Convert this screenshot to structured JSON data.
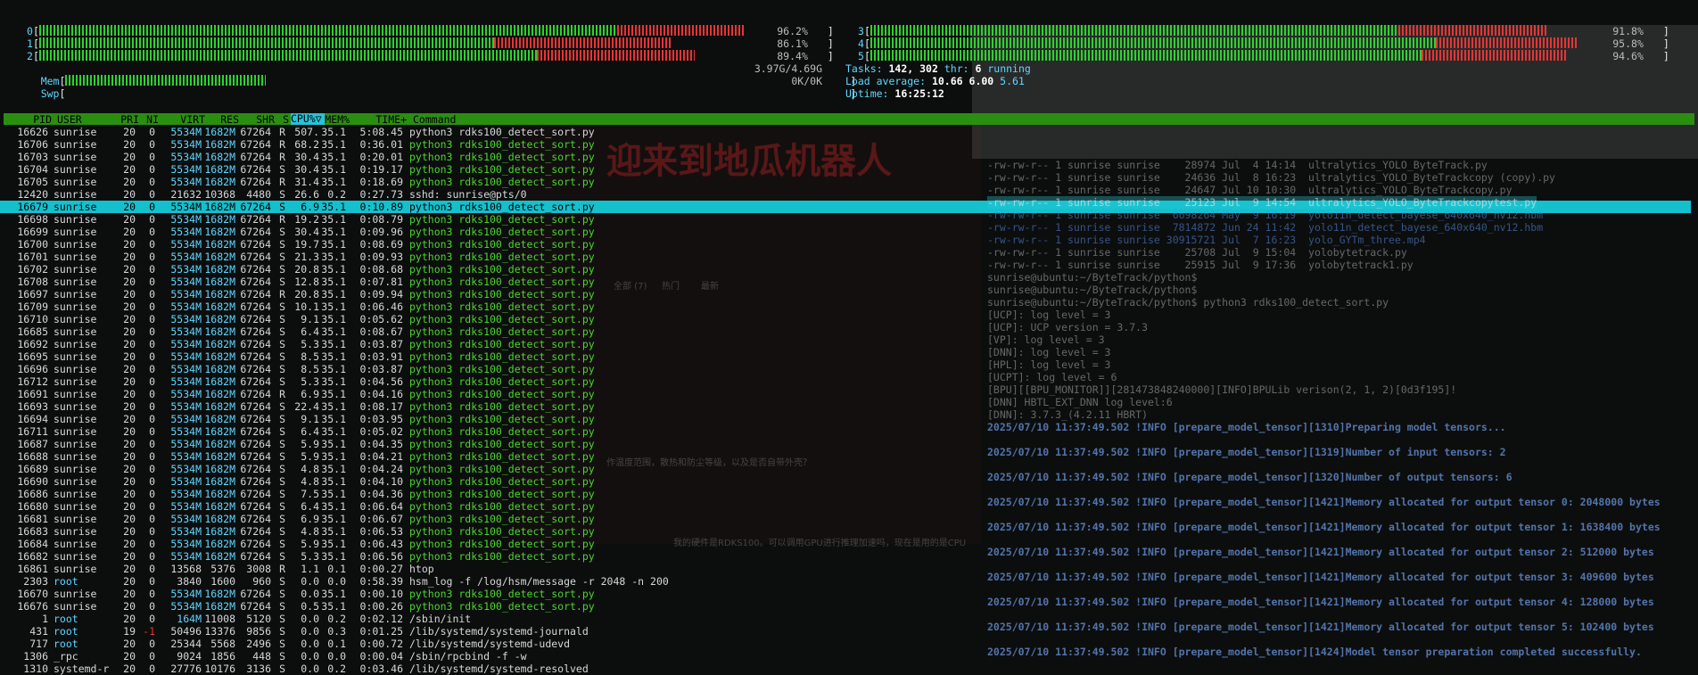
{
  "cpu_meters": [
    {
      "label": "0",
      "value": "96.2%",
      "pct": 96.2,
      "red_from": 0.82
    },
    {
      "label": "1",
      "value": "86.1%",
      "pct": 86.1,
      "red_from": 0.72
    },
    {
      "label": "2",
      "value": "89.4%",
      "pct": 89.4,
      "red_from": 0.76
    },
    {
      "label": "3",
      "value": "91.8%",
      "pct": 91.8,
      "red_from": 0.78
    },
    {
      "label": "4",
      "value": "95.8%",
      "pct": 95.8,
      "red_from": 0.8
    },
    {
      "label": "5",
      "value": "94.6%",
      "pct": 94.6,
      "red_from": 0.79
    }
  ],
  "mem": {
    "label": "Mem",
    "value": "3.97G/4.69G",
    "pct": 85
  },
  "swp": {
    "label": "Swp",
    "value": "0K/0K",
    "pct": 0
  },
  "summary": {
    "tasks_label": "Tasks:",
    "tasks": "142,",
    "thr": "302",
    "thr_label": "thr:",
    "running": "6",
    "running_label": "running",
    "load_label": "Load average:",
    "load1": "10.66",
    "load5": "6.00",
    "load15": "5.61",
    "uptime_label": "Uptime:",
    "uptime": "16:25:12"
  },
  "header": {
    "pid": "PID",
    "user": "USER",
    "pri": "PRI",
    "ni": "NI",
    "virt": "VIRT",
    "res": "RES",
    "shr": "SHR",
    "s": "S",
    "cpu": "CPU%▽",
    "mem": "MEM%",
    "time": "TIME+",
    "command": "Command"
  },
  "processes": [
    {
      "pid": "16626",
      "user": "sunrise",
      "pri": "20",
      "ni": "0",
      "virt": "5534M",
      "res": "1682M",
      "shr": "67264",
      "s": "R",
      "cpu": "507.",
      "mem": "35.1",
      "time": "5:08.45",
      "cmd": "python3 rdks100_detect_sort.py",
      "green": false
    },
    {
      "pid": "16706",
      "user": "sunrise",
      "pri": "20",
      "ni": "0",
      "virt": "5534M",
      "res": "1682M",
      "shr": "67264",
      "s": "R",
      "cpu": "68.2",
      "mem": "35.1",
      "time": "0:36.01",
      "cmd": "python3 rdks100_detect_sort.py",
      "green": true
    },
    {
      "pid": "16703",
      "user": "sunrise",
      "pri": "20",
      "ni": "0",
      "virt": "5534M",
      "res": "1682M",
      "shr": "67264",
      "s": "R",
      "cpu": "30.4",
      "mem": "35.1",
      "time": "0:20.01",
      "cmd": "python3 rdks100_detect_sort.py",
      "green": true
    },
    {
      "pid": "16704",
      "user": "sunrise",
      "pri": "20",
      "ni": "0",
      "virt": "5534M",
      "res": "1682M",
      "shr": "67264",
      "s": "S",
      "cpu": "30.4",
      "mem": "35.1",
      "time": "0:19.17",
      "cmd": "python3 rdks100_detect_sort.py",
      "green": true
    },
    {
      "pid": "16705",
      "user": "sunrise",
      "pri": "20",
      "ni": "0",
      "virt": "5534M",
      "res": "1682M",
      "shr": "67264",
      "s": "R",
      "cpu": "31.4",
      "mem": "35.1",
      "time": "0:18.69",
      "cmd": "python3 rdks100_detect_sort.py",
      "green": true
    },
    {
      "pid": "12420",
      "user": "sunrise",
      "pri": "20",
      "ni": "0",
      "virt": "21632",
      "res": "10368",
      "shr": "4480",
      "s": "S",
      "cpu": "26.6",
      "mem": "0.2",
      "time": "0:27.73",
      "cmd": "sshd: sunrise@pts/0",
      "green": false
    },
    {
      "pid": "16679",
      "user": "sunrise",
      "pri": "20",
      "ni": "0",
      "virt": "5534M",
      "res": "1682M",
      "shr": "67264",
      "s": "S",
      "cpu": "6.9",
      "mem": "35.1",
      "time": "0:10.89",
      "cmd": "python3 rdks100_detect_sort.py",
      "green": true,
      "hl": true
    },
    {
      "pid": "16698",
      "user": "sunrise",
      "pri": "20",
      "ni": "0",
      "virt": "5534M",
      "res": "1682M",
      "shr": "67264",
      "s": "R",
      "cpu": "19.2",
      "mem": "35.1",
      "time": "0:08.79",
      "cmd": "python3 rdks100_detect_sort.py",
      "green": true
    },
    {
      "pid": "16699",
      "user": "sunrise",
      "pri": "20",
      "ni": "0",
      "virt": "5534M",
      "res": "1682M",
      "shr": "67264",
      "s": "S",
      "cpu": "30.4",
      "mem": "35.1",
      "time": "0:09.96",
      "cmd": "python3 rdks100_detect_sort.py",
      "green": true
    },
    {
      "pid": "16700",
      "user": "sunrise",
      "pri": "20",
      "ni": "0",
      "virt": "5534M",
      "res": "1682M",
      "shr": "67264",
      "s": "S",
      "cpu": "19.7",
      "mem": "35.1",
      "time": "0:08.69",
      "cmd": "python3 rdks100_detect_sort.py",
      "green": true
    },
    {
      "pid": "16701",
      "user": "sunrise",
      "pri": "20",
      "ni": "0",
      "virt": "5534M",
      "res": "1682M",
      "shr": "67264",
      "s": "S",
      "cpu": "21.3",
      "mem": "35.1",
      "time": "0:09.93",
      "cmd": "python3 rdks100_detect_sort.py",
      "green": true
    },
    {
      "pid": "16702",
      "user": "sunrise",
      "pri": "20",
      "ni": "0",
      "virt": "5534M",
      "res": "1682M",
      "shr": "67264",
      "s": "S",
      "cpu": "20.8",
      "mem": "35.1",
      "time": "0:08.68",
      "cmd": "python3 rdks100_detect_sort.py",
      "green": true
    },
    {
      "pid": "16708",
      "user": "sunrise",
      "pri": "20",
      "ni": "0",
      "virt": "5534M",
      "res": "1682M",
      "shr": "67264",
      "s": "S",
      "cpu": "12.8",
      "mem": "35.1",
      "time": "0:07.81",
      "cmd": "python3 rdks100_detect_sort.py",
      "green": true
    },
    {
      "pid": "16697",
      "user": "sunrise",
      "pri": "20",
      "ni": "0",
      "virt": "5534M",
      "res": "1682M",
      "shr": "67264",
      "s": "R",
      "cpu": "20.8",
      "mem": "35.1",
      "time": "0:09.94",
      "cmd": "python3 rdks100_detect_sort.py",
      "green": true
    },
    {
      "pid": "16709",
      "user": "sunrise",
      "pri": "20",
      "ni": "0",
      "virt": "5534M",
      "res": "1682M",
      "shr": "67264",
      "s": "S",
      "cpu": "10.1",
      "mem": "35.1",
      "time": "0:06.46",
      "cmd": "python3 rdks100_detect_sort.py",
      "green": true
    },
    {
      "pid": "16710",
      "user": "sunrise",
      "pri": "20",
      "ni": "0",
      "virt": "5534M",
      "res": "1682M",
      "shr": "67264",
      "s": "S",
      "cpu": "9.1",
      "mem": "35.1",
      "time": "0:05.62",
      "cmd": "python3 rdks100_detect_sort.py",
      "green": true
    },
    {
      "pid": "16685",
      "user": "sunrise",
      "pri": "20",
      "ni": "0",
      "virt": "5534M",
      "res": "1682M",
      "shr": "67264",
      "s": "S",
      "cpu": "6.4",
      "mem": "35.1",
      "time": "0:08.67",
      "cmd": "python3 rdks100_detect_sort.py",
      "green": true
    },
    {
      "pid": "16692",
      "user": "sunrise",
      "pri": "20",
      "ni": "0",
      "virt": "5534M",
      "res": "1682M",
      "shr": "67264",
      "s": "S",
      "cpu": "5.3",
      "mem": "35.1",
      "time": "0:03.87",
      "cmd": "python3 rdks100_detect_sort.py",
      "green": true
    },
    {
      "pid": "16695",
      "user": "sunrise",
      "pri": "20",
      "ni": "0",
      "virt": "5534M",
      "res": "1682M",
      "shr": "67264",
      "s": "S",
      "cpu": "8.5",
      "mem": "35.1",
      "time": "0:03.91",
      "cmd": "python3 rdks100_detect_sort.py",
      "green": true
    },
    {
      "pid": "16696",
      "user": "sunrise",
      "pri": "20",
      "ni": "0",
      "virt": "5534M",
      "res": "1682M",
      "shr": "67264",
      "s": "S",
      "cpu": "8.5",
      "mem": "35.1",
      "time": "0:03.87",
      "cmd": "python3 rdks100_detect_sort.py",
      "green": true
    },
    {
      "pid": "16712",
      "user": "sunrise",
      "pri": "20",
      "ni": "0",
      "virt": "5534M",
      "res": "1682M",
      "shr": "67264",
      "s": "S",
      "cpu": "5.3",
      "mem": "35.1",
      "time": "0:04.56",
      "cmd": "python3 rdks100_detect_sort.py",
      "green": true
    },
    {
      "pid": "16691",
      "user": "sunrise",
      "pri": "20",
      "ni": "0",
      "virt": "5534M",
      "res": "1682M",
      "shr": "67264",
      "s": "R",
      "cpu": "6.9",
      "mem": "35.1",
      "time": "0:04.16",
      "cmd": "python3 rdks100_detect_sort.py",
      "green": true
    },
    {
      "pid": "16693",
      "user": "sunrise",
      "pri": "20",
      "ni": "0",
      "virt": "5534M",
      "res": "1682M",
      "shr": "67264",
      "s": "S",
      "cpu": "22.4",
      "mem": "35.1",
      "time": "0:08.17",
      "cmd": "python3 rdks100_detect_sort.py",
      "green": true
    },
    {
      "pid": "16694",
      "user": "sunrise",
      "pri": "20",
      "ni": "0",
      "virt": "5534M",
      "res": "1682M",
      "shr": "67264",
      "s": "S",
      "cpu": "9.1",
      "mem": "35.1",
      "time": "0:03.95",
      "cmd": "python3 rdks100_detect_sort.py",
      "green": true
    },
    {
      "pid": "16711",
      "user": "sunrise",
      "pri": "20",
      "ni": "0",
      "virt": "5534M",
      "res": "1682M",
      "shr": "67264",
      "s": "S",
      "cpu": "6.4",
      "mem": "35.1",
      "time": "0:05.02",
      "cmd": "python3 rdks100_detect_sort.py",
      "green": true
    },
    {
      "pid": "16687",
      "user": "sunrise",
      "pri": "20",
      "ni": "0",
      "virt": "5534M",
      "res": "1682M",
      "shr": "67264",
      "s": "S",
      "cpu": "5.9",
      "mem": "35.1",
      "time": "0:04.35",
      "cmd": "python3 rdks100_detect_sort.py",
      "green": true
    },
    {
      "pid": "16688",
      "user": "sunrise",
      "pri": "20",
      "ni": "0",
      "virt": "5534M",
      "res": "1682M",
      "shr": "67264",
      "s": "S",
      "cpu": "5.9",
      "mem": "35.1",
      "time": "0:04.21",
      "cmd": "python3 rdks100_detect_sort.py",
      "green": true
    },
    {
      "pid": "16689",
      "user": "sunrise",
      "pri": "20",
      "ni": "0",
      "virt": "5534M",
      "res": "1682M",
      "shr": "67264",
      "s": "S",
      "cpu": "4.8",
      "mem": "35.1",
      "time": "0:04.24",
      "cmd": "python3 rdks100_detect_sort.py",
      "green": true
    },
    {
      "pid": "16690",
      "user": "sunrise",
      "pri": "20",
      "ni": "0",
      "virt": "5534M",
      "res": "1682M",
      "shr": "67264",
      "s": "S",
      "cpu": "4.8",
      "mem": "35.1",
      "time": "0:04.10",
      "cmd": "python3 rdks100_detect_sort.py",
      "green": true
    },
    {
      "pid": "16686",
      "user": "sunrise",
      "pri": "20",
      "ni": "0",
      "virt": "5534M",
      "res": "1682M",
      "shr": "67264",
      "s": "S",
      "cpu": "7.5",
      "mem": "35.1",
      "time": "0:04.36",
      "cmd": "python3 rdks100_detect_sort.py",
      "green": true
    },
    {
      "pid": "16680",
      "user": "sunrise",
      "pri": "20",
      "ni": "0",
      "virt": "5534M",
      "res": "1682M",
      "shr": "67264",
      "s": "S",
      "cpu": "6.4",
      "mem": "35.1",
      "time": "0:06.64",
      "cmd": "python3 rdks100_detect_sort.py",
      "green": true
    },
    {
      "pid": "16681",
      "user": "sunrise",
      "pri": "20",
      "ni": "0",
      "virt": "5534M",
      "res": "1682M",
      "shr": "67264",
      "s": "S",
      "cpu": "6.9",
      "mem": "35.1",
      "time": "0:06.67",
      "cmd": "python3 rdks100_detect_sort.py",
      "green": true
    },
    {
      "pid": "16683",
      "user": "sunrise",
      "pri": "20",
      "ni": "0",
      "virt": "5534M",
      "res": "1682M",
      "shr": "67264",
      "s": "S",
      "cpu": "4.8",
      "mem": "35.1",
      "time": "0:06.53",
      "cmd": "python3 rdks100_detect_sort.py",
      "green": true
    },
    {
      "pid": "16684",
      "user": "sunrise",
      "pri": "20",
      "ni": "0",
      "virt": "5534M",
      "res": "1682M",
      "shr": "67264",
      "s": "S",
      "cpu": "5.9",
      "mem": "35.1",
      "time": "0:06.43",
      "cmd": "python3 rdks100_detect_sort.py",
      "green": true
    },
    {
      "pid": "16682",
      "user": "sunrise",
      "pri": "20",
      "ni": "0",
      "virt": "5534M",
      "res": "1682M",
      "shr": "67264",
      "s": "S",
      "cpu": "5.3",
      "mem": "35.1",
      "time": "0:06.56",
      "cmd": "python3 rdks100_detect_sort.py",
      "green": true
    },
    {
      "pid": "16861",
      "user": "sunrise",
      "pri": "20",
      "ni": "0",
      "virt": "13568",
      "res": "5376",
      "shr": "3008",
      "s": "R",
      "cpu": "1.1",
      "mem": "0.1",
      "time": "0:00.27",
      "cmd": "htop",
      "green": false
    },
    {
      "pid": "2303",
      "user": "root",
      "pri": "20",
      "ni": "0",
      "virt": "3840",
      "res": "1600",
      "shr": "960",
      "s": "S",
      "cpu": "0.0",
      "mem": "0.0",
      "time": "0:58.39",
      "cmd": "hsm_log -f /log/hsm/message -r 2048 -n 200",
      "green": false
    },
    {
      "pid": "16670",
      "user": "sunrise",
      "pri": "20",
      "ni": "0",
      "virt": "5534M",
      "res": "1682M",
      "shr": "67264",
      "s": "S",
      "cpu": "0.0",
      "mem": "35.1",
      "time": "0:00.10",
      "cmd": "python3 rdks100_detect_sort.py",
      "green": true
    },
    {
      "pid": "16676",
      "user": "sunrise",
      "pri": "20",
      "ni": "0",
      "virt": "5534M",
      "res": "1682M",
      "shr": "67264",
      "s": "S",
      "cpu": "0.5",
      "mem": "35.1",
      "time": "0:00.26",
      "cmd": "python3 rdks100_detect_sort.py",
      "green": true
    },
    {
      "pid": "1",
      "user": "root",
      "pri": "20",
      "ni": "0",
      "virt": "164M",
      "res": "11008",
      "shr": "5120",
      "s": "S",
      "cpu": "0.0",
      "mem": "0.2",
      "time": "0:02.12",
      "cmd": "/sbin/init",
      "green": false
    },
    {
      "pid": "431",
      "user": "root",
      "pri": "19",
      "ni": "-1",
      "virt": "50496",
      "res": "13376",
      "shr": "9856",
      "s": "S",
      "cpu": "0.0",
      "mem": "0.3",
      "time": "0:01.25",
      "cmd": "/lib/systemd/systemd-journald",
      "green": false
    },
    {
      "pid": "717",
      "user": "root",
      "pri": "20",
      "ni": "0",
      "virt": "25344",
      "res": "5568",
      "shr": "2496",
      "s": "S",
      "cpu": "0.0",
      "mem": "0.1",
      "time": "0:00.72",
      "cmd": "/lib/systemd/systemd-udevd",
      "green": false
    },
    {
      "pid": "1306",
      "user": "_rpc",
      "pri": "20",
      "ni": "0",
      "virt": "9024",
      "res": "1856",
      "shr": "448",
      "s": "S",
      "cpu": "0.0",
      "mem": "0.0",
      "time": "0:00.04",
      "cmd": "/sbin/rpcbind -f -w",
      "green": false
    },
    {
      "pid": "1310",
      "user": "systemd-r",
      "pri": "20",
      "ni": "0",
      "virt": "27776",
      "res": "10176",
      "shr": "3136",
      "s": "S",
      "cpu": "0.0",
      "mem": "0.2",
      "time": "0:03.46",
      "cmd": "/lib/systemd/systemd-resolved",
      "green": false
    }
  ],
  "right_terminal": [
    {
      "text": "-rw-rw-r-- 1 sunrise sunrise    28974 Jul  4 14:14  ultralytics_YOLO_ByteTrack.py",
      "style": ""
    },
    {
      "text": "-rw-rw-r-- 1 sunrise sunrise    24636 Jul  8 16:23  ultralytics_YOLO_ByteTrackcopy (copy).py",
      "style": ""
    },
    {
      "text": "-rw-rw-r-- 1 sunrise sunrise    24647 Jul 10 10:30  ultralytics_YOLO_ByteTrackcopy.py",
      "style": ""
    },
    {
      "text": "-rw-rw-r-- 1 sunrise sunrise    25123 Jul  9 14:54  ultralytics_YOLO_ByteTrackcopytest.py",
      "style": "sel"
    },
    {
      "text": "-rw-rw-r-- 1 sunrise sunrise  6698264 May  9 16:19  yolo11n_detect_bayese_640x640_nv12.hbm",
      "style": "blue"
    },
    {
      "text": "-rw-rw-r-- 1 sunrise sunrise  7814872 Jun 24 11:42  yolo11n_detect_bayese_640x640_nv12.hbm",
      "style": "blue"
    },
    {
      "text": "-rw-rw-r-- 1 sunrise sunrise 30915721 Jul  7 16:23  yolo_GYTm_three.mp4",
      "style": "blue"
    },
    {
      "text": "-rw-rw-r-- 1 sunrise sunrise    25708 Jul  9 15:04  yolobytetrack.py",
      "style": ""
    },
    {
      "text": "-rw-rw-r-- 1 sunrise sunrise    25915 Jul  9 17:36  yolobytetrack1.py",
      "style": ""
    },
    {
      "text": "sunrise@ubuntu:~/ByteTrack/python$",
      "style": ""
    },
    {
      "text": "sunrise@ubuntu:~/ByteTrack/python$",
      "style": ""
    },
    {
      "text": "sunrise@ubuntu:~/ByteTrack/python$ python3 rdks100_detect_sort.py",
      "style": ""
    },
    {
      "text": "[UCP]: log level = 3",
      "style": ""
    },
    {
      "text": "[UCP]: UCP version = 3.7.3",
      "style": ""
    },
    {
      "text": "[VP]: log level = 3",
      "style": ""
    },
    {
      "text": "[DNN]: log level = 3",
      "style": ""
    },
    {
      "text": "[HPL]: log level = 3",
      "style": ""
    },
    {
      "text": "[UCPT]: log level = 6",
      "style": ""
    },
    {
      "text": "[BPU][[BPU_MONITOR]][281473848240000][INFO]BPULib verison(2, 1, 2)[0d3f195]!",
      "style": ""
    },
    {
      "text": "[DNN] HBTL_EXT_DNN log level:6",
      "style": ""
    },
    {
      "text": "[DNN]: 3.7.3_(4.2.11 HBRT)",
      "style": ""
    },
    {
      "text": "2025/07/10 11:37:49.502 !INFO [prepare_model_tensor][1310]Preparing model tensors...",
      "style": "bold"
    },
    {
      "text": "",
      "style": ""
    },
    {
      "text": "2025/07/10 11:37:49.502 !INFO [prepare_model_tensor][1319]Number of input tensors: 2",
      "style": "bold"
    },
    {
      "text": "",
      "style": ""
    },
    {
      "text": "2025/07/10 11:37:49.502 !INFO [prepare_model_tensor][1320]Number of output tensors: 6",
      "style": "bold"
    },
    {
      "text": "",
      "style": ""
    },
    {
      "text": "2025/07/10 11:37:49.502 !INFO [prepare_model_tensor][1421]Memory allocated for output tensor 0: 2048000 bytes",
      "style": "bold"
    },
    {
      "text": "",
      "style": ""
    },
    {
      "text": "2025/07/10 11:37:49.502 !INFO [prepare_model_tensor][1421]Memory allocated for output tensor 1: 1638400 bytes",
      "style": "bold"
    },
    {
      "text": "",
      "style": ""
    },
    {
      "text": "2025/07/10 11:37:49.502 !INFO [prepare_model_tensor][1421]Memory allocated for output tensor 2: 512000 bytes",
      "style": "bold"
    },
    {
      "text": "",
      "style": ""
    },
    {
      "text": "2025/07/10 11:37:49.502 !INFO [prepare_model_tensor][1421]Memory allocated for output tensor 3: 409600 bytes",
      "style": "bold"
    },
    {
      "text": "",
      "style": ""
    },
    {
      "text": "2025/07/10 11:37:49.502 !INFO [prepare_model_tensor][1421]Memory allocated for output tensor 4: 128000 bytes",
      "style": "bold"
    },
    {
      "text": "",
      "style": ""
    },
    {
      "text": "2025/07/10 11:37:49.502 !INFO [prepare_model_tensor][1421]Memory allocated for output tensor 5: 102400 bytes",
      "style": "bold"
    },
    {
      "text": "",
      "style": ""
    },
    {
      "text": "2025/07/10 11:37:49.502 !INFO [prepare_model_tensor][1424]Model tensor preparation completed successfully.",
      "style": "bold"
    }
  ],
  "ghost": {
    "banner": "迎来到地瓜机器人",
    "tabs": [
      "全部 (7)",
      "热门",
      "最新"
    ],
    "question": "作温度范围，散热和防尘等级，以及是否自带外壳？",
    "note": "我的硬件是RDKS100。可以调用GPU进行推理加速吗，现在是用的是CPU"
  },
  "colors": {
    "header_bar": "#2a8f10",
    "selected_row": "#15c0cd",
    "green_text": "#4cd62c",
    "meter_green": "#2fd12f",
    "meter_red": "#e83434",
    "cyan": "#5fd7ff"
  }
}
